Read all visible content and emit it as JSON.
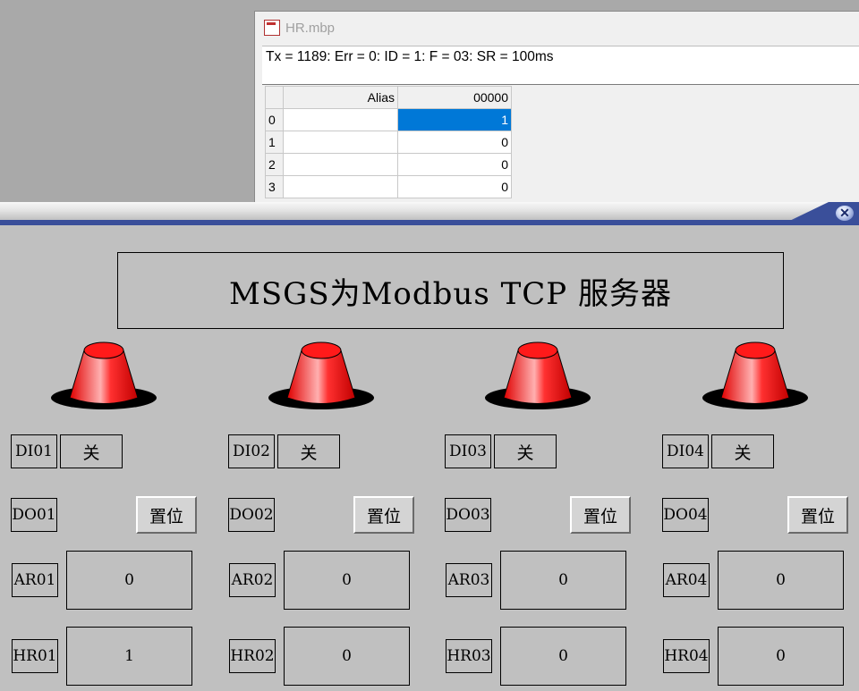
{
  "modbus_window": {
    "title": "HR.mbp",
    "status": "Tx = 1189: Err = 0: ID = 1: F = 03: SR = 100ms",
    "columns": {
      "alias": "Alias",
      "address": "00000"
    },
    "rows": [
      {
        "index": "0",
        "alias": "",
        "value": "1"
      },
      {
        "index": "1",
        "alias": "",
        "value": "0"
      },
      {
        "index": "2",
        "alias": "",
        "value": "0"
      },
      {
        "index": "3",
        "alias": "",
        "value": "0"
      }
    ]
  },
  "app": {
    "close_glyph": "✕",
    "banner": "MSGS为Modbus TCP 服务器",
    "lamp_color": "#ff1a1a",
    "channels": [
      {
        "di_label": "DI01",
        "di_state": "关",
        "do_label": "DO01",
        "do_button": "置位",
        "ar_label": "AR01",
        "ar_value": "0",
        "hr_label": "HR01",
        "hr_value": "1"
      },
      {
        "di_label": "DI02",
        "di_state": "关",
        "do_label": "DO02",
        "do_button": "置位",
        "ar_label": "AR02",
        "ar_value": "0",
        "hr_label": "HR02",
        "hr_value": "0"
      },
      {
        "di_label": "DI03",
        "di_state": "关",
        "do_label": "DO03",
        "do_button": "置位",
        "ar_label": "AR03",
        "ar_value": "0",
        "hr_label": "HR03",
        "hr_value": "0"
      },
      {
        "di_label": "DI04",
        "di_state": "关",
        "do_label": "DO04",
        "do_button": "置位",
        "ar_label": "AR04",
        "ar_value": "0",
        "hr_label": "HR04",
        "hr_value": "0"
      }
    ]
  }
}
